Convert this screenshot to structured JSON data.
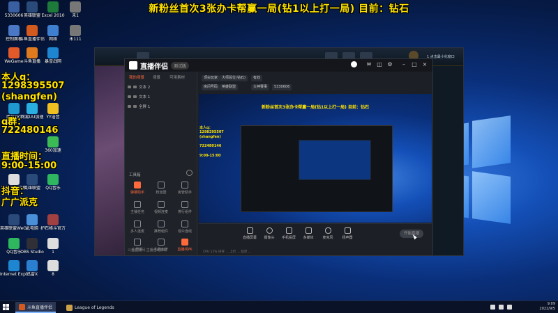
{
  "overlay": {
    "title": "新粉丝首次3张办卡帮赢一局(钻1以上打一局)  目前：钻石",
    "qq_label": "本人q：",
    "qq_number": "1298395507",
    "qq_alias": "(shangfen)",
    "group_label": "q群：",
    "group_number": "722480146",
    "hours_label": "直播时间：",
    "hours_value": "9:00-15:00",
    "douyin_label": "抖音：",
    "douyin_value": "广广派克"
  },
  "desktop": {
    "icons": [
      {
        "label": "5330606",
        "color": "#3a5fa0"
      },
      {
        "label": "英雄联盟",
        "color": "#2a4a7a"
      },
      {
        "label": "Excel 2010",
        "color": "#1d7a3a"
      },
      {
        "label": "未1",
        "color": "#777"
      },
      {
        "label": "控制面板",
        "color": "#4a78c4"
      },
      {
        "label": "斗鱼直播伴侣",
        "color": "#d25a1e"
      },
      {
        "label": "网络",
        "color": "#3f7fd0"
      },
      {
        "label": "未111",
        "color": "#777"
      },
      {
        "label": "WeGame",
        "color": "#e25a2a"
      },
      {
        "label": "斗鱼直播",
        "color": "#e07a1e"
      },
      {
        "label": "暴雪战网",
        "color": "#1e86d0"
      },
      {
        "label": "腾讯QQ",
        "color": "#1e9ad0"
      },
      {
        "label": "网易UU加速",
        "color": "#2ab0e0"
      },
      {
        "label": "YY语音",
        "color": "#f0c020"
      },
      {
        "label": "360加速",
        "color": "#3cba54"
      },
      {
        "label": "新建文本文档",
        "color": "#ddd"
      },
      {
        "label": "英雄联盟",
        "color": "#2a4a7a"
      },
      {
        "label": "QQ音乐",
        "color": "#2fb760"
      },
      {
        "label": "英雄联盟WeGame版",
        "color": "#2a4a7a"
      },
      {
        "label": "此电脑",
        "color": "#4a90d9"
      },
      {
        "label": "护石格斗官方",
        "color": "#a04040"
      },
      {
        "label": "QQ音乐",
        "color": "#2fb760"
      },
      {
        "label": "OBS Studio",
        "color": "#302e36"
      },
      {
        "label": "1",
        "color": "#ddd"
      },
      {
        "label": "Internet Explorer",
        "color": "#1e86d0"
      },
      {
        "label": "迅雷X",
        "color": "#2a7fd0"
      },
      {
        "label": "8",
        "color": "#ddd"
      }
    ]
  },
  "app": {
    "name": "直播伴侣",
    "badge": "测试版",
    "left_tabs": [
      "我的场景",
      "场景",
      "可用素材"
    ],
    "scenes": [
      "文本 2",
      "文本 1",
      "全屏 1"
    ],
    "tools_title": "工具箱",
    "tools": [
      "弹幕助手",
      "粉丝团",
      "房管助手",
      "主播任务",
      "视频连麦",
      "排行组件",
      "多人连麦",
      "推荐组件",
      "观众连线",
      "心愿单",
      "礼物大厅",
      "直播间PK"
    ],
    "footer": "斗鱼直播间·主播自动弹幕",
    "preview_chips": [
      "顶尖玩家",
      "大师段位(钻石)",
      "有效",
      "房间号码",
      "英雄联盟",
      "大神赛事",
      "5330606"
    ],
    "bottom_buttons": [
      "直播屏幕",
      "摄像头",
      "手机投屏",
      "多媒体",
      "麦克风",
      "扬声器"
    ],
    "start_button": "开始直播",
    "status": "CPU 11%  内存 ...  上行 ...  延迟 ..."
  },
  "right_mini": "1 点击最小化窗口",
  "taskbar": {
    "items": [
      {
        "label": "斗鱼直播伴侣",
        "color": "#d25a1e"
      },
      {
        "label": "League of Legends",
        "color": "#c9a24a"
      }
    ],
    "time": "9:09",
    "date": "2022/9/5"
  }
}
